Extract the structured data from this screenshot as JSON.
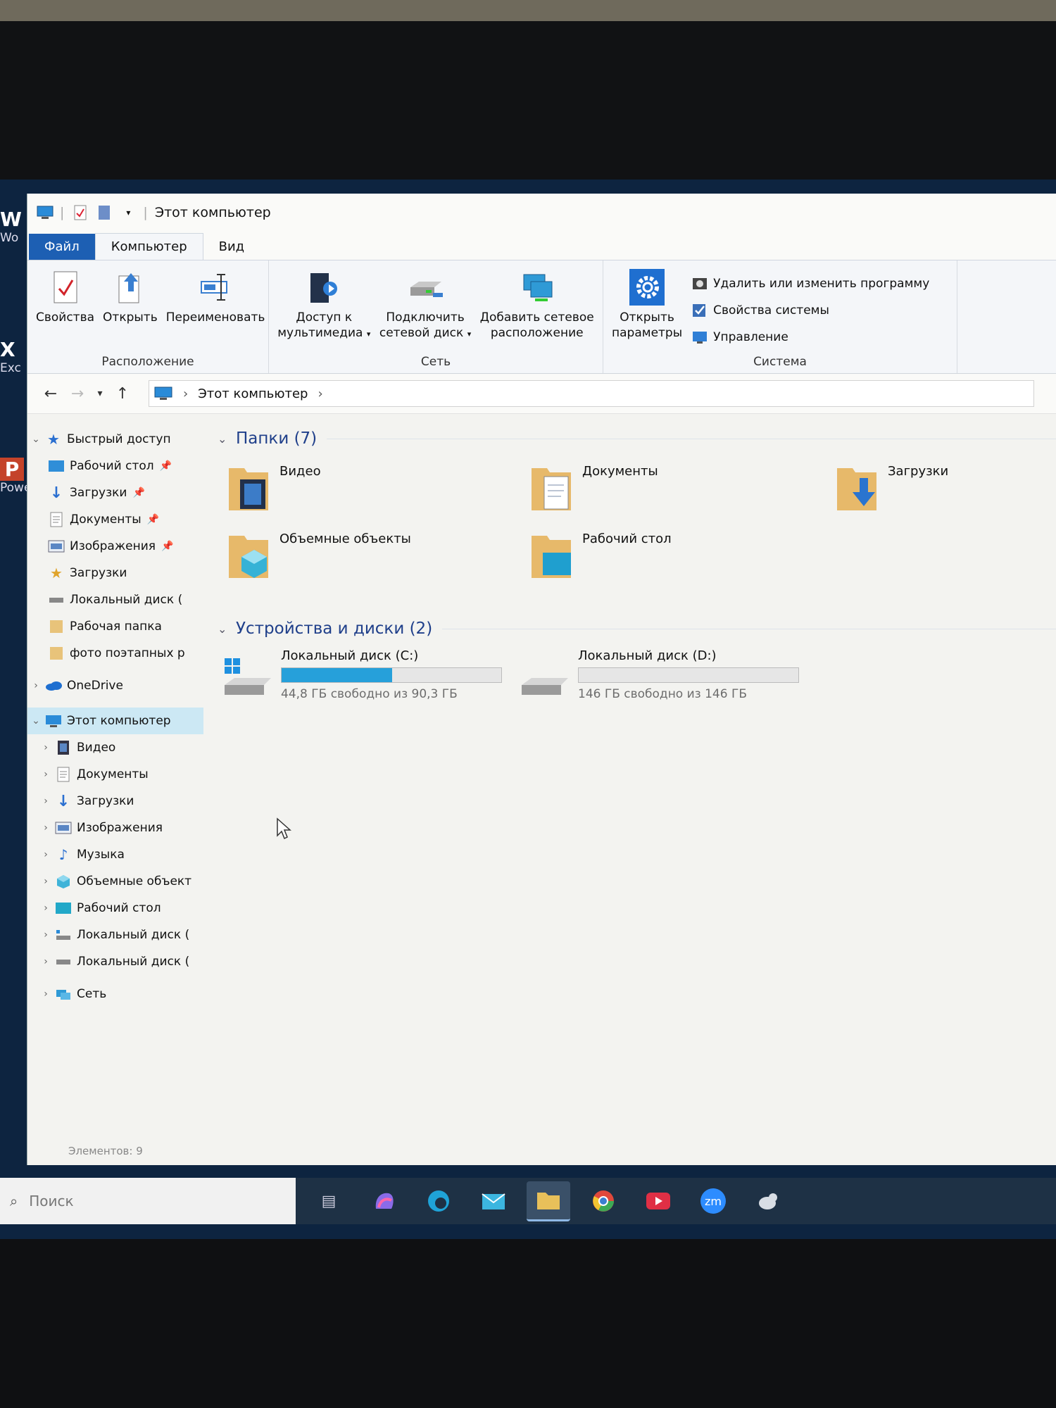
{
  "window": {
    "title": "Этот компьютер"
  },
  "desktop_icons": [
    {
      "glyph": "W",
      "caption": "Wo"
    },
    {
      "glyph": "X",
      "caption": "Exc"
    },
    {
      "glyph": "P",
      "caption": "Power"
    }
  ],
  "ribbon": {
    "tabs": [
      "Файл",
      "Компьютер",
      "Вид"
    ],
    "groups": {
      "location": {
        "label": "Расположение",
        "buttons": [
          "Свойства",
          "Открыть",
          "Переименовать"
        ]
      },
      "network": {
        "label": "Сеть",
        "media_line1": "Доступ к",
        "media_line2": "мультимедиа",
        "map_line1": "Подключить",
        "map_line2": "сетевой диск",
        "add_line1": "Добавить сетевое",
        "add_line2": "расположение"
      },
      "system": {
        "label": "Система",
        "open_line1": "Открыть",
        "open_line2": "параметры",
        "small": [
          "Удалить или изменить программу",
          "Свойства системы",
          "Управление"
        ]
      }
    }
  },
  "address": {
    "path": "Этот компьютер"
  },
  "sidebar": {
    "quick_access": "Быстрый доступ",
    "quick_items": [
      "Рабочий стол",
      "Загрузки",
      "Документы",
      "Изображения",
      "Загрузки",
      "Локальный диск (",
      "Рабочая папка",
      "фото поэтапных р"
    ],
    "onedrive": "OneDrive",
    "this_pc": "Этот компьютер",
    "pc_items": [
      "Видео",
      "Документы",
      "Загрузки",
      "Изображения",
      "Музыка",
      "Объемные объект",
      "Рабочий стол",
      "Локальный диск (",
      "Локальный диск ("
    ],
    "network": "Сеть"
  },
  "folders": {
    "heading": "Папки (7)",
    "items": [
      "Видео",
      "Документы",
      "Загрузки",
      "Объемные объекты",
      "Рабочий стол"
    ]
  },
  "devices": {
    "heading": "Устройства и диски (2)",
    "drives": [
      {
        "name": "Локальный диск (C:)",
        "free_text": "44,8 ГБ свободно из 90,3 ГБ",
        "used_fraction": 0.504
      },
      {
        "name": "Локальный диск (D:)",
        "free_text": "146 ГБ свободно из 146 ГБ",
        "used_fraction": 0.0
      }
    ]
  },
  "status": {
    "items_count": "Элементов: 9"
  },
  "taskbar": {
    "search_placeholder": "Поиск",
    "apps": [
      "task-view-icon",
      "copilot-icon",
      "edge-icon",
      "mail-icon",
      "explorer-icon",
      "chrome-icon",
      "youtube-icon",
      "zoom-icon",
      "bird-app-icon"
    ],
    "zoom_label": "zm"
  },
  "colors": {
    "accent": "#1d5fb3",
    "drive_bar": "#26a0da",
    "section_heading": "#1f3f8a",
    "selection": "#cce8f4"
  }
}
